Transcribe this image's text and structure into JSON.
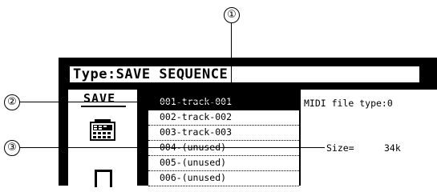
{
  "callouts": [
    "①",
    "②",
    "③"
  ],
  "title": "Type:SAVE SEQUENCE",
  "left_panel": {
    "save_label": "SAVE",
    "device_icon": "sequencer-device-icon",
    "door_icon": "exit-door-icon"
  },
  "tracks": [
    "001-track-001",
    "002-track-002",
    "003-track-003",
    "004-(unused)",
    "005-(unused)",
    "006-(unused)"
  ],
  "selected_track": "001-track-001",
  "info": {
    "midi_file_type": "MIDI file type:0",
    "size_label": "Size=",
    "size_value": "34k"
  },
  "colors": {
    "lcd_background": "#000000",
    "lcd_foreground": "#ffffff",
    "text": "#000000"
  }
}
